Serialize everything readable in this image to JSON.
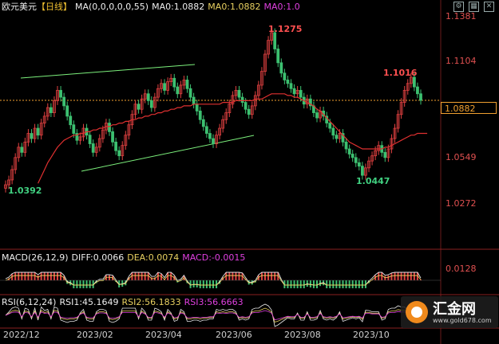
{
  "header": {
    "symbol": "欧元美元",
    "period": "【日线】",
    "ma_label": "MA(0,0,0,0,0,55)",
    "ma0_gold": "MA0:1.0882",
    "ma0_gold2": "MA0:1.0882",
    "ma0_magenta": "MA0:1.0"
  },
  "macd_header": {
    "name": "MACD(26,12,9)",
    "diff": "DIFF:0.0066",
    "dea": "DEA:0.0074",
    "macd": "MACD:-0.0015"
  },
  "rsi_header": {
    "name": "RSI(6,12,24)",
    "rsi1": "RSI1:45.1649",
    "rsi2": "RSI2:56.1833",
    "rsi3": "RSI3:56.6663"
  },
  "current_price": "1.0882",
  "watermark": {
    "name": "汇金网",
    "url": "www.gold678.com"
  },
  "colors": {
    "up": "#e04040",
    "down": "#3cc070",
    "ma": "#e03030",
    "trend": "#7cf07c",
    "current": "#f0a030"
  },
  "chart_data": {
    "type": "candlestick",
    "title": "欧元美元【日线】",
    "y_ticks": [
      "1.1381",
      "1.1104",
      "1.0826",
      "1.0549",
      "1.0272",
      "0.0128"
    ],
    "x_ticks": [
      "2022/12",
      "2023/02",
      "2023/04",
      "2023/06",
      "2023/08",
      "2023/10"
    ],
    "annotations": [
      {
        "label": "1.0392",
        "kind": "low"
      },
      {
        "label": "1.1275",
        "kind": "high"
      },
      {
        "label": "1.0447",
        "kind": "low"
      },
      {
        "label": "1.1016",
        "kind": "high"
      }
    ],
    "ylim": [
      1.0272,
      1.1381
    ],
    "closes": [
      1.0392,
      1.042,
      1.048,
      1.055,
      1.061,
      1.058,
      1.064,
      1.069,
      1.066,
      1.072,
      1.068,
      1.075,
      1.079,
      1.084,
      1.081,
      1.088,
      1.094,
      1.09,
      1.085,
      1.079,
      1.074,
      1.069,
      1.065,
      1.067,
      1.072,
      1.068,
      1.063,
      1.058,
      1.061,
      1.066,
      1.071,
      1.075,
      1.07,
      1.064,
      1.059,
      1.056,
      1.062,
      1.068,
      1.074,
      1.08,
      1.086,
      1.083,
      1.089,
      1.092,
      1.088,
      1.084,
      1.09,
      1.095,
      1.098,
      1.094,
      1.099,
      1.101,
      1.096,
      1.092,
      1.097,
      1.1,
      1.095,
      1.09,
      1.086,
      1.082,
      1.077,
      1.073,
      1.069,
      1.066,
      1.063,
      1.068,
      1.072,
      1.077,
      1.081,
      1.086,
      1.091,
      1.094,
      1.09,
      1.087,
      1.083,
      1.08,
      1.085,
      1.091,
      1.097,
      1.105,
      1.115,
      1.123,
      1.1275,
      1.118,
      1.11,
      1.104,
      1.1,
      1.098,
      1.095,
      1.092,
      1.094,
      1.09,
      1.086,
      1.089,
      1.085,
      1.081,
      1.078,
      1.082,
      1.079,
      1.075,
      1.072,
      1.068,
      1.066,
      1.069,
      1.064,
      1.06,
      1.057,
      1.055,
      1.052,
      1.05,
      1.0447,
      1.049,
      1.053,
      1.056,
      1.059,
      1.062,
      1.058,
      1.055,
      1.06,
      1.066,
      1.072,
      1.08,
      1.087,
      1.094,
      1.098,
      1.1016,
      1.096,
      1.092,
      1.0882
    ],
    "ma55": [
      null,
      null,
      null,
      null,
      null,
      null,
      null,
      null,
      null,
      null,
      1.04,
      1.044,
      1.048,
      1.052,
      1.055,
      1.058,
      1.061,
      1.063,
      1.065,
      1.066,
      1.067,
      1.068,
      1.068,
      1.069,
      1.069,
      1.07,
      1.07,
      1.071,
      1.071,
      1.072,
      1.072,
      1.073,
      1.073,
      1.074,
      1.074,
      1.075,
      1.075,
      1.076,
      1.076,
      1.077,
      1.077,
      1.078,
      1.078,
      1.079,
      1.079,
      1.08,
      1.08,
      1.081,
      1.081,
      1.082,
      1.082,
      1.083,
      1.083,
      1.084,
      1.084,
      1.085,
      1.085,
      1.085,
      1.086,
      1.086,
      1.086,
      1.086,
      1.086,
      1.086,
      1.086,
      1.086,
      1.086,
      1.087,
      1.087,
      1.087,
      1.087,
      1.088,
      1.088,
      1.088,
      1.088,
      1.088,
      1.088,
      1.089,
      1.089,
      1.089,
      1.09,
      1.091,
      1.092,
      1.092,
      1.092,
      1.092,
      1.092,
      1.091,
      1.091,
      1.09,
      1.09,
      1.089,
      1.088,
      1.087,
      1.086,
      1.085,
      1.083,
      1.082,
      1.08,
      1.078,
      1.076,
      1.074,
      1.072,
      1.07,
      1.068,
      1.066,
      1.064,
      1.063,
      1.062,
      1.061,
      1.06,
      1.06,
      1.06,
      1.06,
      1.06,
      1.06,
      1.06,
      1.061,
      1.061,
      1.062,
      1.063,
      1.064,
      1.065,
      1.066,
      1.067,
      1.068,
      1.068,
      1.069,
      1.069,
      1.069,
      1.069
    ]
  }
}
